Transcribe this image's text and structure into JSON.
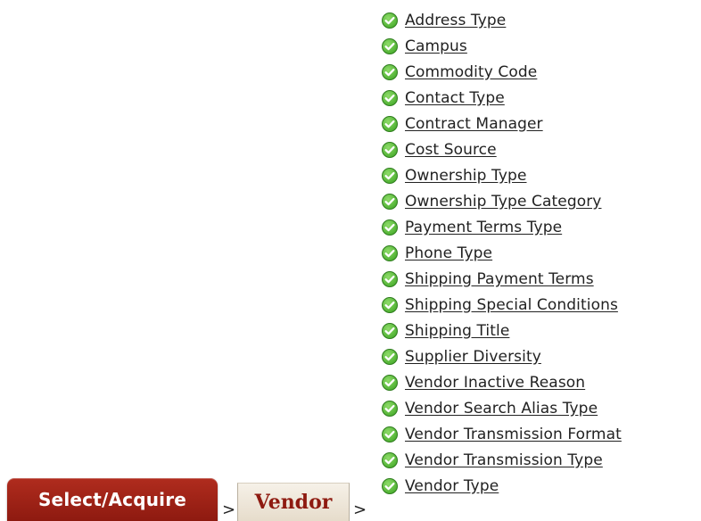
{
  "breadcrumb": {
    "tabs": [
      {
        "label": "Select/Acquire"
      },
      {
        "label": "Vendor"
      }
    ],
    "separator": ">"
  },
  "menu": {
    "icon": "check-circle-icon",
    "icon_color": "#4caf30",
    "items": [
      {
        "label": "Address Type"
      },
      {
        "label": "Campus"
      },
      {
        "label": "Commodity Code"
      },
      {
        "label": "Contact Type"
      },
      {
        "label": "Contract Manager"
      },
      {
        "label": "Cost Source"
      },
      {
        "label": "Ownership Type"
      },
      {
        "label": "Ownership Type Category"
      },
      {
        "label": "Payment Terms Type"
      },
      {
        "label": "Phone Type"
      },
      {
        "label": "Shipping Payment Terms"
      },
      {
        "label": "Shipping Special Conditions"
      },
      {
        "label": "Shipping Title"
      },
      {
        "label": "Supplier Diversity"
      },
      {
        "label": "Vendor Inactive Reason"
      },
      {
        "label": "Vendor Search Alias Type"
      },
      {
        "label": "Vendor Transmission Format"
      },
      {
        "label": "Vendor Transmission Type"
      },
      {
        "label": "Vendor Type"
      }
    ]
  },
  "colors": {
    "primary_tab": "#9e2214",
    "secondary_tab_text": "#8e1a10",
    "link_text": "#222222"
  }
}
